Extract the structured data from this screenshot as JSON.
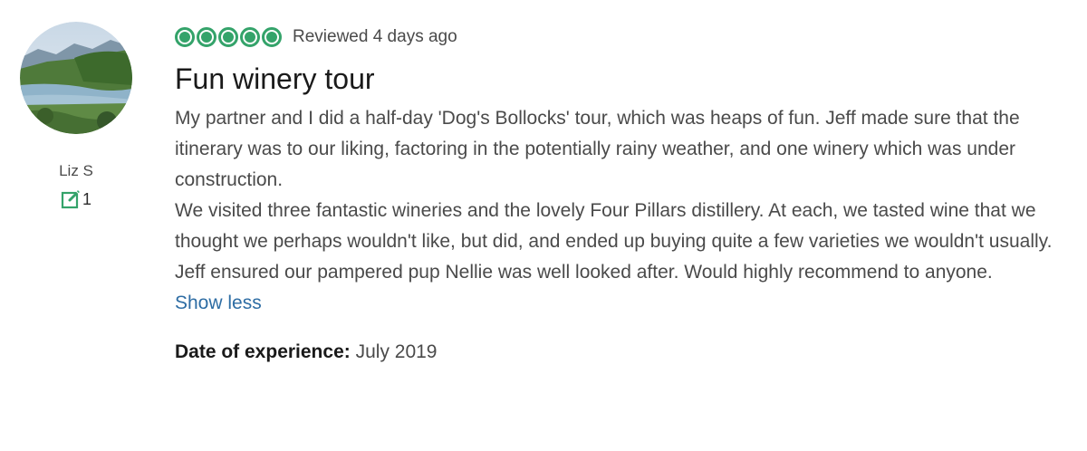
{
  "reviewer": {
    "name": "Liz S",
    "contributions": "1",
    "avatar_icon": "landscape-photo"
  },
  "review": {
    "rating": 5,
    "rating_color": "#34a36a",
    "reviewed_text": "Reviewed 4 days ago",
    "title": "Fun winery tour",
    "paragraphs": [
      "My partner and I did a half-day 'Dog's Bollocks' tour, which was heaps of fun. Jeff made sure that the itinerary was to our liking, factoring in the potentially rainy weather, and one winery which was under construction.",
      "We visited three fantastic wineries and the lovely Four Pillars distillery. At each, we tasted wine that we thought we perhaps wouldn't like, but did, and ended up buying quite a few varieties we wouldn't usually.",
      "Jeff ensured our pampered pup Nellie was well looked after. Would highly recommend to anyone."
    ],
    "show_less_label": "Show less",
    "link_color": "#2e6da4",
    "experience_label": "Date of experience:",
    "experience_date": "July 2019"
  }
}
